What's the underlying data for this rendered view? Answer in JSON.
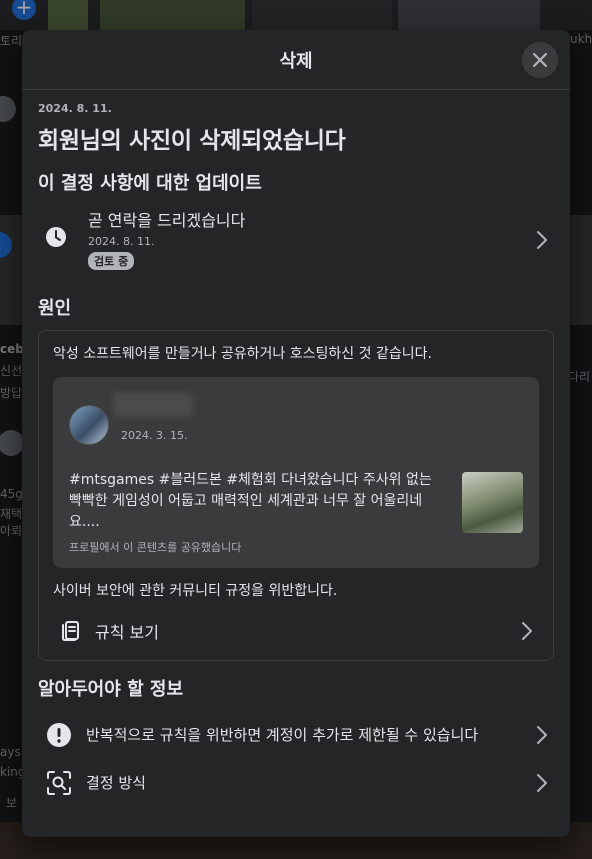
{
  "background": {
    "left_fragments": [
      "토리",
      "ceb",
      "신선",
      "방답",
      "45g",
      "재택",
      "아뢰",
      "ays",
      "king",
      "보"
    ],
    "right_fragments": [
      "ukh",
      "다리"
    ]
  },
  "modal": {
    "title": "삭제",
    "close_icon": "close-icon",
    "date": "2024. 8. 11.",
    "headline": "회원님의 사진이 삭제되었습니다",
    "updates_section": {
      "title": "이 결정 사항에 대한 업데이트",
      "item": {
        "icon": "clock-icon",
        "text": "곧 연락을 드리겠습니다",
        "date": "2024. 8. 11.",
        "badge": "검토 중"
      }
    },
    "reason_section": {
      "title": "원인",
      "reason": "악성 소프트웨어를 만들거나 공유하거나 호스팅하신 것 같습니다.",
      "post": {
        "date": "2024. 3. 15.",
        "text": "#mtsgames #블러드본 #체험회 다녀왔습니다 주사위 없는 빡빡한 게임성이 어둡고 매력적인 세계관과 너무 잘 어울리네요....",
        "footer": "프로필에서 이 콘텐츠를 공유했습니다"
      },
      "violation": "사이버 보안에 관한 커뮤니티 규정을 위반합니다.",
      "rules_link": "규칙 보기"
    },
    "info_section": {
      "title": "알아두어야 할 정보",
      "items": [
        {
          "icon": "alert-icon",
          "text": "반복적으로 규칙을 위반하면 계정이 추가로 제한될 수 있습니다"
        },
        {
          "icon": "search-face-icon",
          "text": "결정 방식"
        }
      ]
    }
  }
}
